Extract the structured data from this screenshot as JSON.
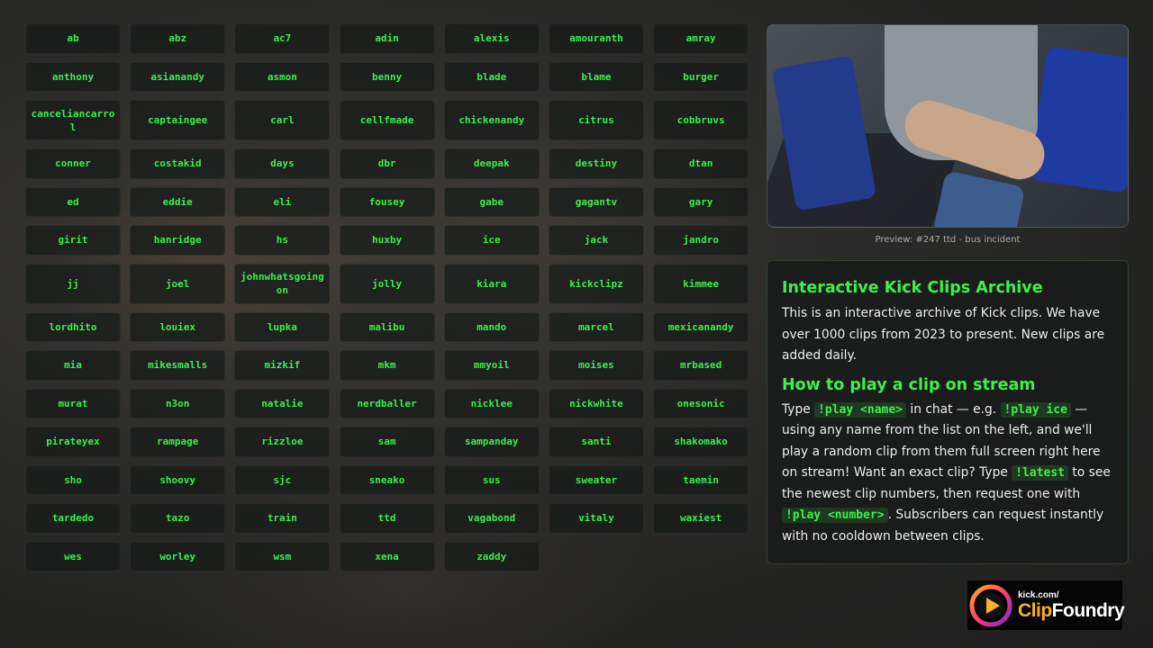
{
  "names": [
    "ab",
    "abz",
    "ac7",
    "adin",
    "alexis",
    "amouranth",
    "amray",
    "anthony",
    "asianandy",
    "asmon",
    "benny",
    "blade",
    "blame",
    "burger",
    "canceliancarrol",
    "captaingee",
    "carl",
    "cellfmade",
    "chickenandy",
    "citrus",
    "cobbruvs",
    "conner",
    "costakid",
    "days",
    "dbr",
    "deepak",
    "destiny",
    "dtan",
    "ed",
    "eddie",
    "eli",
    "fousey",
    "gabe",
    "gagantv",
    "gary",
    "girit",
    "hanridge",
    "hs",
    "huxby",
    "ice",
    "jack",
    "jandro",
    "jj",
    "joel",
    "johnwhatsgoingon",
    "jolly",
    "kiara",
    "kickclipz",
    "kimmee",
    "lordhito",
    "louiex",
    "lupka",
    "malibu",
    "mando",
    "marcel",
    "mexicanandy",
    "mia",
    "mikesmalls",
    "mizkif",
    "mkm",
    "mmyoil",
    "moises",
    "mrbased",
    "murat",
    "n3on",
    "natalie",
    "nerdballer",
    "nicklee",
    "nickwhite",
    "onesonic",
    "pirateyex",
    "rampage",
    "rizzloe",
    "sam",
    "sampanday",
    "santi",
    "shakomako",
    "sho",
    "shoovy",
    "sjc",
    "sneako",
    "sus",
    "sweater",
    "taemin",
    "tardedo",
    "tazo",
    "train",
    "ttd",
    "vagabond",
    "vitaly",
    "waxiest",
    "wes",
    "worley",
    "wsm",
    "xena",
    "zaddy"
  ],
  "preview": {
    "caption": "Preview: #247 ttd - bus incident"
  },
  "info": {
    "title": "Interactive Kick Clips Archive",
    "intro": "This is an interactive archive of Kick clips. We have over 1000 clips from 2023 to present. New clips are added daily.",
    "howto_title": "How to play a clip on stream",
    "howto_1": "Type ",
    "cmd_play_name": "!play <name>",
    "howto_2": " in chat — e.g. ",
    "cmd_play_ice": "!play ice",
    "howto_3": " — using any name from the list on the left, and we'll play a random clip from them full screen right here on stream! Want an exact clip? Type ",
    "cmd_latest": "!latest",
    "howto_4": " to see the newest clip numbers, then request one with ",
    "cmd_play_number": "!play <number>",
    "howto_5": ". Subscribers can request instantly with no cooldown between clips."
  },
  "logo": {
    "small": "kick.com/",
    "clip": "Clip",
    "foundry": "Foundry"
  },
  "colors": {
    "accent": "#39f04a",
    "logo_orange": "#ffb020",
    "logo_purple": "#7a2bd0"
  }
}
